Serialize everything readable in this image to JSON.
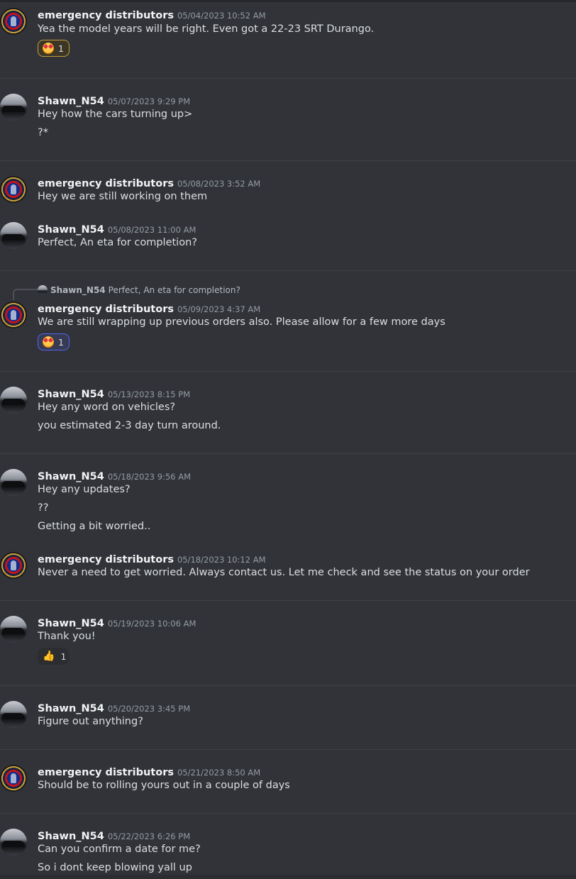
{
  "messages": [
    {
      "user": "emergency distributors",
      "time": "05/04/2023 10:52 AM",
      "lines": [
        "Yea the model years will be right.  Even got a 22-23 SRT Durango."
      ],
      "reaction": {
        "type": "heart-eyes",
        "count": "1"
      }
    },
    {
      "user": "Shawn_N54",
      "time": "05/07/2023 9:29 PM",
      "lines": [
        "Hey how the cars turning up>",
        "?*"
      ]
    },
    {
      "user": "emergency distributors",
      "time": "05/08/2023 3:52 AM",
      "lines": [
        "Hey we are still working on them"
      ]
    },
    {
      "user": "Shawn_N54",
      "time": "05/08/2023 11:00 AM",
      "lines": [
        "Perfect, An eta for completion?"
      ]
    },
    {
      "user": "emergency distributors",
      "time": "05/09/2023 4:37 AM",
      "reply": {
        "user": "Shawn_N54",
        "text": "Perfect, An eta for completion?"
      },
      "lines": [
        "We are still wrapping up previous orders also. Please allow for a few more days"
      ],
      "reaction": {
        "type": "heart-eyes",
        "count": "1"
      }
    },
    {
      "user": "Shawn_N54",
      "time": "05/13/2023 8:15 PM",
      "lines": [
        "Hey any word on vehicles?",
        "you estimated 2-3 day turn around."
      ]
    },
    {
      "user": "Shawn_N54",
      "time": "05/18/2023 9:56 AM",
      "lines": [
        "Hey any updates?",
        "??",
        "Getting a bit worried.."
      ]
    },
    {
      "user": "emergency distributors",
      "time": "05/18/2023 10:12 AM",
      "lines": [
        "Never a need to get worried. Always contact us. Let me check and see the status on your order"
      ]
    },
    {
      "user": "Shawn_N54",
      "time": "05/19/2023 10:06 AM",
      "lines": [
        "Thank you!"
      ],
      "reaction": {
        "type": "thumbs-up",
        "count": "1"
      }
    },
    {
      "user": "Shawn_N54",
      "time": "05/20/2023 3:45 PM",
      "lines": [
        "Figure out anything?"
      ]
    },
    {
      "user": "emergency distributors",
      "time": "05/21/2023 8:50 AM",
      "lines": [
        "Should be to rolling yours out in a couple of days"
      ]
    },
    {
      "user": "Shawn_N54",
      "time": "05/22/2023 6:26 PM",
      "lines": [
        "Can you confirm a date for me?",
        "So i dont keep blowing yall up"
      ]
    }
  ],
  "colors": {
    "background": "#313338",
    "username": "#f2f3f5",
    "timestamp": "#949ba4",
    "text": "#dbdee1"
  }
}
